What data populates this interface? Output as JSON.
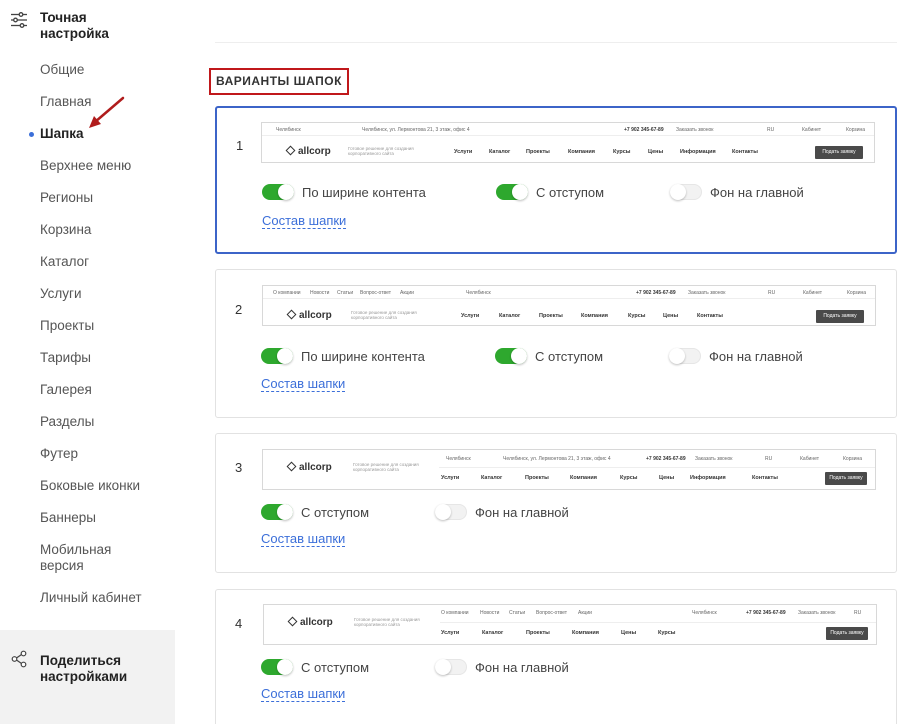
{
  "sidebar": {
    "title": "Точная настройка",
    "items": [
      {
        "label": "Общие"
      },
      {
        "label": "Главная"
      },
      {
        "label": "Шапка"
      },
      {
        "label": "Верхнее меню"
      },
      {
        "label": "Регионы"
      },
      {
        "label": "Корзина"
      },
      {
        "label": "Каталог"
      },
      {
        "label": "Услуги"
      },
      {
        "label": "Проекты"
      },
      {
        "label": "Тарифы"
      },
      {
        "label": "Галерея"
      },
      {
        "label": "Разделы"
      },
      {
        "label": "Футер"
      },
      {
        "label": "Боковые иконки"
      },
      {
        "label": "Баннеры"
      },
      {
        "label": "Мобильная версия"
      },
      {
        "label": "Личный кабинет"
      }
    ],
    "active_index": 2,
    "share_label": "Поделиться настройками"
  },
  "section_title": "ВАРИАНТЫ ШАПОК",
  "accent_color": "#3c64c8",
  "toggle_on_color": "#2ea82e",
  "link_color": "#3c6fd9",
  "preview_text": {
    "city": "Челябинск",
    "address": "Челябинск, ул. Лермонтова 21, 3 этаж, офис 4",
    "phone": "+7 902 345-67-89",
    "callback": "Заказать звонок",
    "lang": "RU",
    "cabinet": "Кабинет",
    "cart": "Корзина",
    "logo": "allcorp",
    "slogan": "Готовое решение для создания корпоративного сайта",
    "request": "Подать заявку",
    "topmenu": [
      "О компании",
      "Новости",
      "Статьи",
      "Вопрос-ответ",
      "Акции"
    ],
    "nav_full": [
      "Услуги",
      "Каталог",
      "Проекты",
      "Компания",
      "Курсы",
      "Цены",
      "Информация",
      "Контакты"
    ],
    "nav_short": [
      "Услуги",
      "Каталог",
      "Проекты",
      "Компания",
      "Курсы",
      "Цены",
      "Контакты"
    ],
    "nav_four": [
      "Услуги",
      "Каталог",
      "Проекты",
      "Компания",
      "Цены",
      "Курсы"
    ]
  },
  "variants": [
    {
      "number": "1",
      "options": [
        {
          "label": "По ширине контента",
          "on": true
        },
        {
          "label": "С отступом",
          "on": true
        },
        {
          "label": "Фон на главной",
          "on": false
        }
      ],
      "link": "Состав шапки",
      "selected": true
    },
    {
      "number": "2",
      "options": [
        {
          "label": "По ширине контента",
          "on": true
        },
        {
          "label": "С отступом",
          "on": true
        },
        {
          "label": "Фон на главной",
          "on": false
        }
      ],
      "link": "Состав шапки",
      "selected": false
    },
    {
      "number": "3",
      "options": [
        {
          "label": "С отступом",
          "on": true
        },
        {
          "label": "Фон на главной",
          "on": false
        }
      ],
      "link": "Состав шапки",
      "selected": false
    },
    {
      "number": "4",
      "options": [
        {
          "label": "С отступом",
          "on": true
        },
        {
          "label": "Фон на главной",
          "on": false
        }
      ],
      "link": "Состав шапки",
      "selected": false
    }
  ]
}
